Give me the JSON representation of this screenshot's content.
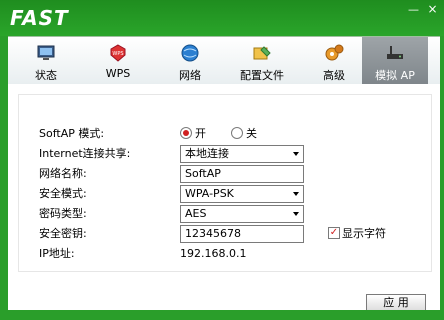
{
  "app": {
    "logo": "FAST",
    "minimize_label": "—",
    "close_label": "×"
  },
  "tabs": [
    {
      "label": "状态",
      "icon": "monitor-icon"
    },
    {
      "label": "WPS",
      "icon": "wps-icon"
    },
    {
      "label": "网络",
      "icon": "network-globe-icon"
    },
    {
      "label": "配置文件",
      "icon": "profile-folder-icon"
    },
    {
      "label": "高级",
      "icon": "gears-icon"
    },
    {
      "label": "模拟 AP",
      "icon": "router-icon",
      "active": true
    }
  ],
  "form": {
    "softap_label": "SoftAP 模式:",
    "softap_on": "开",
    "softap_off": "关",
    "softap_selected": "on",
    "share_label": "Internet连接共享:",
    "share_value": "本地连接",
    "ssid_label": "网络名称:",
    "ssid_value": "SoftAP",
    "security_label": "安全模式:",
    "security_value": "WPA-PSK",
    "cipher_label": "密码类型:",
    "cipher_value": "AES",
    "key_label": "安全密钥:",
    "key_value": "12345678",
    "show_chars_label": "显示字符",
    "show_chars_checked": true,
    "ip_label": "IP地址:",
    "ip_value": "192.168.0.1"
  },
  "buttons": {
    "apply": "应 用"
  },
  "colors": {
    "frame_green": "#2a9e2a",
    "radio_accent": "#d02020",
    "active_tab": "#8a9094"
  }
}
